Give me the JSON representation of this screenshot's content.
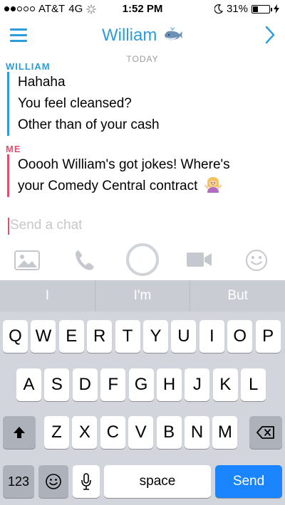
{
  "status_bar": {
    "carrier": "AT&T",
    "network": "4G",
    "time": "1:52 PM",
    "battery_text": "31%",
    "battery_level": 0.31,
    "signal_bars_filled": 2,
    "signal_bars_total": 5
  },
  "header": {
    "title": "William",
    "title_emoji": "whale-icon",
    "menu_icon": "hamburger-menu-icon",
    "forward_icon": "chevron-right-icon",
    "accent_color": "#2d9cdb"
  },
  "conversation": {
    "date_label": "TODAY",
    "blocks": [
      {
        "sender": "WILLIAM",
        "color": "#2d9cdb",
        "lines": [
          "Hahaha",
          "You feel cleansed?",
          "Other than of your cash"
        ]
      },
      {
        "sender": "ME",
        "color": "#e34e6f",
        "lines": [
          "Ooooh William's got jokes! Where's",
          "your Comedy Central contract"
        ],
        "trailing_emoji": "woman-shrugging-emoji"
      }
    ]
  },
  "chat_input": {
    "placeholder": "Send a chat",
    "value": ""
  },
  "tools": {
    "photo_icon": "photo-icon",
    "call_icon": "phone-icon",
    "capture_icon": "capture-circle-icon",
    "video_icon": "video-icon",
    "sticker_icon": "smiley-icon"
  },
  "keyboard": {
    "suggestions": [
      "I",
      "I'm",
      "But"
    ],
    "row1": [
      "Q",
      "W",
      "E",
      "R",
      "T",
      "Y",
      "U",
      "I",
      "O",
      "P"
    ],
    "row2": [
      "A",
      "S",
      "D",
      "F",
      "G",
      "H",
      "J",
      "K",
      "L"
    ],
    "row3": [
      "Z",
      "X",
      "C",
      "V",
      "B",
      "N",
      "M"
    ],
    "numbers_label": "123",
    "space_label": "space",
    "send_label": "Send",
    "shift_icon": "shift-arrow-icon",
    "delete_icon": "backspace-icon",
    "emoji_icon": "emoji-keyboard-icon",
    "mic_icon": "microphone-icon"
  }
}
